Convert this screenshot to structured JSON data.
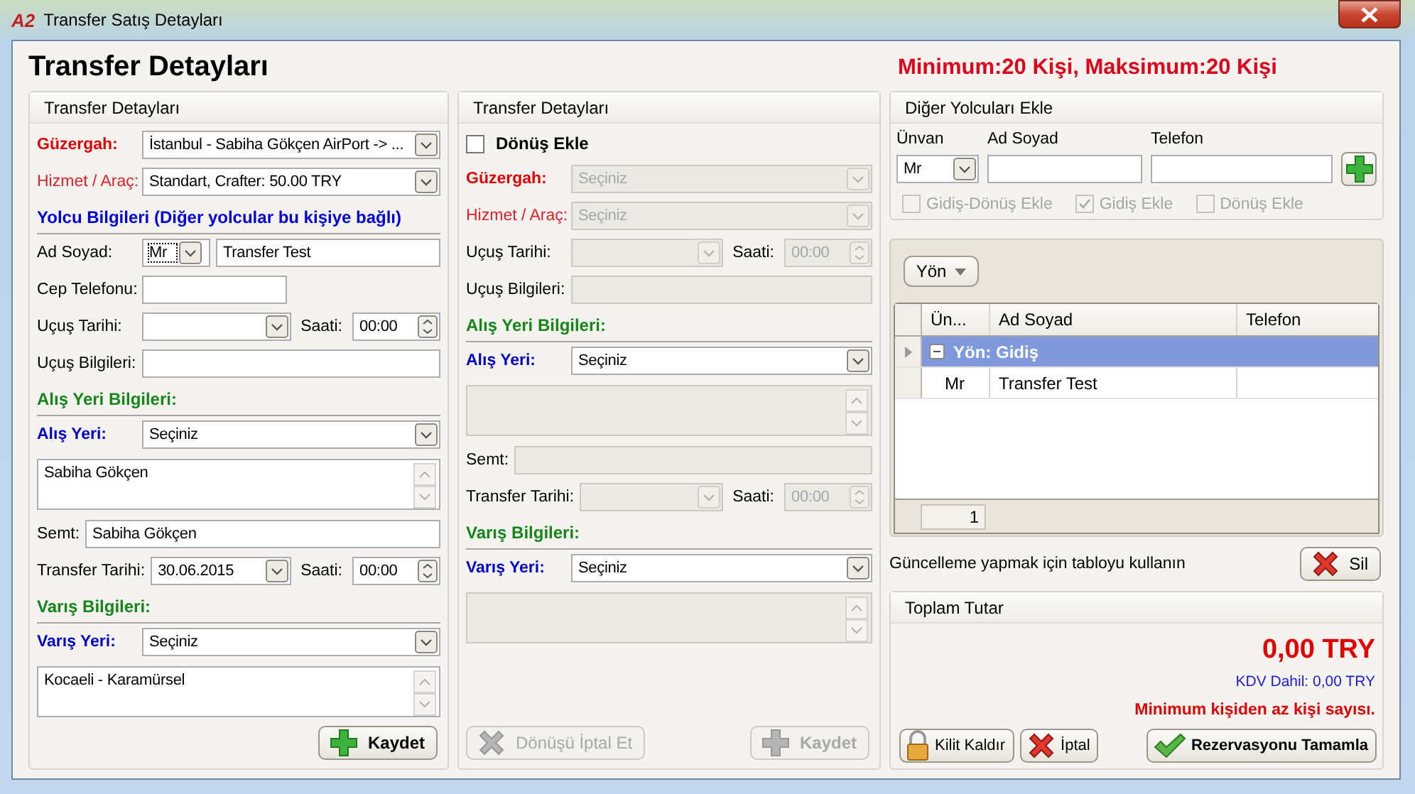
{
  "window": {
    "logo": "A2",
    "title": "Transfer Satış Detayları"
  },
  "page_title": "Transfer Detayları",
  "capacity": "Minimum:20 Kişi, Maksimum:20 Kişi",
  "panels": [
    {
      "title": "Transfer Detayları",
      "rows": [
        {
          "kind": "select",
          "label": "Güzergah:",
          "color": "#e00000",
          "emphasized": true,
          "value": "İstanbul - Sabiha Gökçen AirPort -> ...",
          "disabled": false
        },
        {
          "kind": "select",
          "label": "Hizmet / Araç:",
          "color": "#e0202a",
          "emphasized": false,
          "value": "Standart, Crafter: 50.00 TRY",
          "disabled": false
        },
        {
          "kind": "heading",
          "text": "Yolcu Bilgileri (Diğer yolcular bu kişiye bağlı)",
          "color": "#0000dd"
        },
        {
          "kind": "name",
          "label": "Ad Soyad:",
          "color": "#000000",
          "emphasized": false,
          "title": "Mr",
          "value": "Transfer Test",
          "disabled": false
        },
        {
          "kind": "phone",
          "label": "Cep Telefonu:",
          "color": "#000000",
          "emphasized": false,
          "disabled": false
        },
        {
          "kind": "datetime",
          "label": "Uçuş Tarihi:",
          "color": "#000000",
          "emphasized": false,
          "time_label": "Saati:",
          "time": "00:00",
          "disabled": false
        },
        {
          "kind": "text",
          "label": "Uçuş Bilgileri:",
          "color": "#000000",
          "emphasized": false,
          "disabled": false
        },
        {
          "kind": "heading",
          "text": "Alış Yeri Bilgileri:",
          "color": "#16861a"
        },
        {
          "kind": "select",
          "label": "Alış Yeri:",
          "color": "#0000c8",
          "emphasized": true,
          "value": "Seçiniz",
          "disabled": false
        },
        {
          "kind": "memo",
          "value": "Sabiha Gökçen",
          "disabled": false
        },
        {
          "kind": "inline-text",
          "label": "Semt:",
          "color": "#000000",
          "emphasized": false,
          "value": "Sabiha Gökçen",
          "disabled": false
        },
        {
          "kind": "inline-datetime",
          "label": "Transfer Tarihi:",
          "color": "#000000",
          "emphasized": false,
          "date": "30.06.2015",
          "time_label": "Saati:",
          "time": "00:00",
          "disabled": false
        },
        {
          "kind": "heading",
          "text": "Varış Bilgileri:",
          "color": "#16861a"
        },
        {
          "kind": "select",
          "label": "Varış Yeri:",
          "color": "#0000c8",
          "emphasized": true,
          "value": "Seçiniz",
          "disabled": false
        },
        {
          "kind": "memo",
          "value": "Kocaeli - Karamürsel",
          "disabled": false
        }
      ],
      "buttons": [
        {
          "label": "Kaydet",
          "kind": "save",
          "primary": true,
          "disabled": false
        }
      ]
    },
    {
      "title": "Transfer Detayları",
      "checkbox": {
        "label": "Dönüş Ekle",
        "checked": false
      },
      "rows": [
        {
          "kind": "select",
          "label": "Güzergah:",
          "color": "#e00000",
          "emphasized": true,
          "value": "Seçiniz",
          "disabled": true
        },
        {
          "kind": "select",
          "label": "Hizmet / Araç:",
          "color": "#e0202a",
          "emphasized": false,
          "value": "Seçiniz",
          "disabled": true
        },
        {
          "kind": "datetime",
          "label": "Uçuş Tarihi:",
          "color": "#000000",
          "emphasized": false,
          "time_label": "Saati:",
          "time": "00:00",
          "disabled": true
        },
        {
          "kind": "text",
          "label": "Uçuş Bilgileri:",
          "color": "#000000",
          "emphasized": false,
          "disabled": true
        },
        {
          "kind": "heading",
          "text": "Alış Yeri Bilgileri:",
          "color": "#16861a"
        },
        {
          "kind": "select",
          "label": "Alış Yeri:",
          "color": "#0000c8",
          "emphasized": true,
          "value": "Seçiniz",
          "disabled": false
        },
        {
          "kind": "memo",
          "disabled": true
        },
        {
          "kind": "inline-text",
          "label": "Semt:",
          "color": "#000000",
          "emphasized": false,
          "disabled": true
        },
        {
          "kind": "inline-datetime",
          "label": "Transfer Tarihi:",
          "color": "#000000",
          "emphasized": false,
          "time_label": "Saati:",
          "time": "00:00",
          "disabled": true
        },
        {
          "kind": "heading",
          "text": "Varış Bilgileri:",
          "color": "#16861a"
        },
        {
          "kind": "select",
          "label": "Varış Yeri:",
          "color": "#0000c8",
          "emphasized": true,
          "value": "Seçiniz",
          "disabled": false
        },
        {
          "kind": "memo",
          "disabled": true
        }
      ],
      "buttons": [
        {
          "label": "Dönüşü İptal Et",
          "kind": "cancel",
          "primary": false,
          "disabled": true
        },
        {
          "label": "Kaydet",
          "kind": "save",
          "primary": true,
          "disabled": true
        }
      ]
    }
  ],
  "other_passengers": {
    "title": "Diğer Yolcuları Ekle",
    "title_label": "Ünvan",
    "title_value": "Mr",
    "name_label": "Ad Soyad",
    "phone_label": "Telefon",
    "options": [
      {
        "label": "Gidiş-Dönüş Ekle",
        "checked": false,
        "disabled": true
      },
      {
        "label": "Gidiş Ekle",
        "checked": true,
        "disabled": true
      },
      {
        "label": "Dönüş Ekle",
        "checked": false,
        "disabled": true
      }
    ]
  },
  "grid": {
    "group_button": "Yön",
    "columns": [
      "Ün...",
      "Ad Soyad",
      "Telefon"
    ],
    "groups": [
      {
        "label": "Yön: Gidiş",
        "expanded": true,
        "selected": true,
        "rows": [
          {
            "title": "Mr",
            "name": "Transfer Test"
          }
        ]
      }
    ],
    "count": "1"
  },
  "grid_hint": "Güncelleme yapmak için tabloyu kullanın",
  "delete_button": {
    "label": "Sil",
    "kind": "cancel",
    "primary": false,
    "disabled": false
  },
  "total": {
    "title": "Toplam Tutar",
    "amount": "0,00 TRY",
    "tax": "KDV Dahil: 0,00 TRY",
    "warning": "Minimum kişiden az kişi sayısı."
  },
  "actions": [
    {
      "label": "Kilit Kaldır",
      "kind": "unlock",
      "primary": false,
      "disabled": false
    },
    {
      "label": "İptal",
      "kind": "cancel",
      "primary": false,
      "disabled": false
    },
    {
      "label": "Rezervasyonu Tamamla",
      "kind": "confirm",
      "primary": true,
      "disabled": false
    }
  ]
}
